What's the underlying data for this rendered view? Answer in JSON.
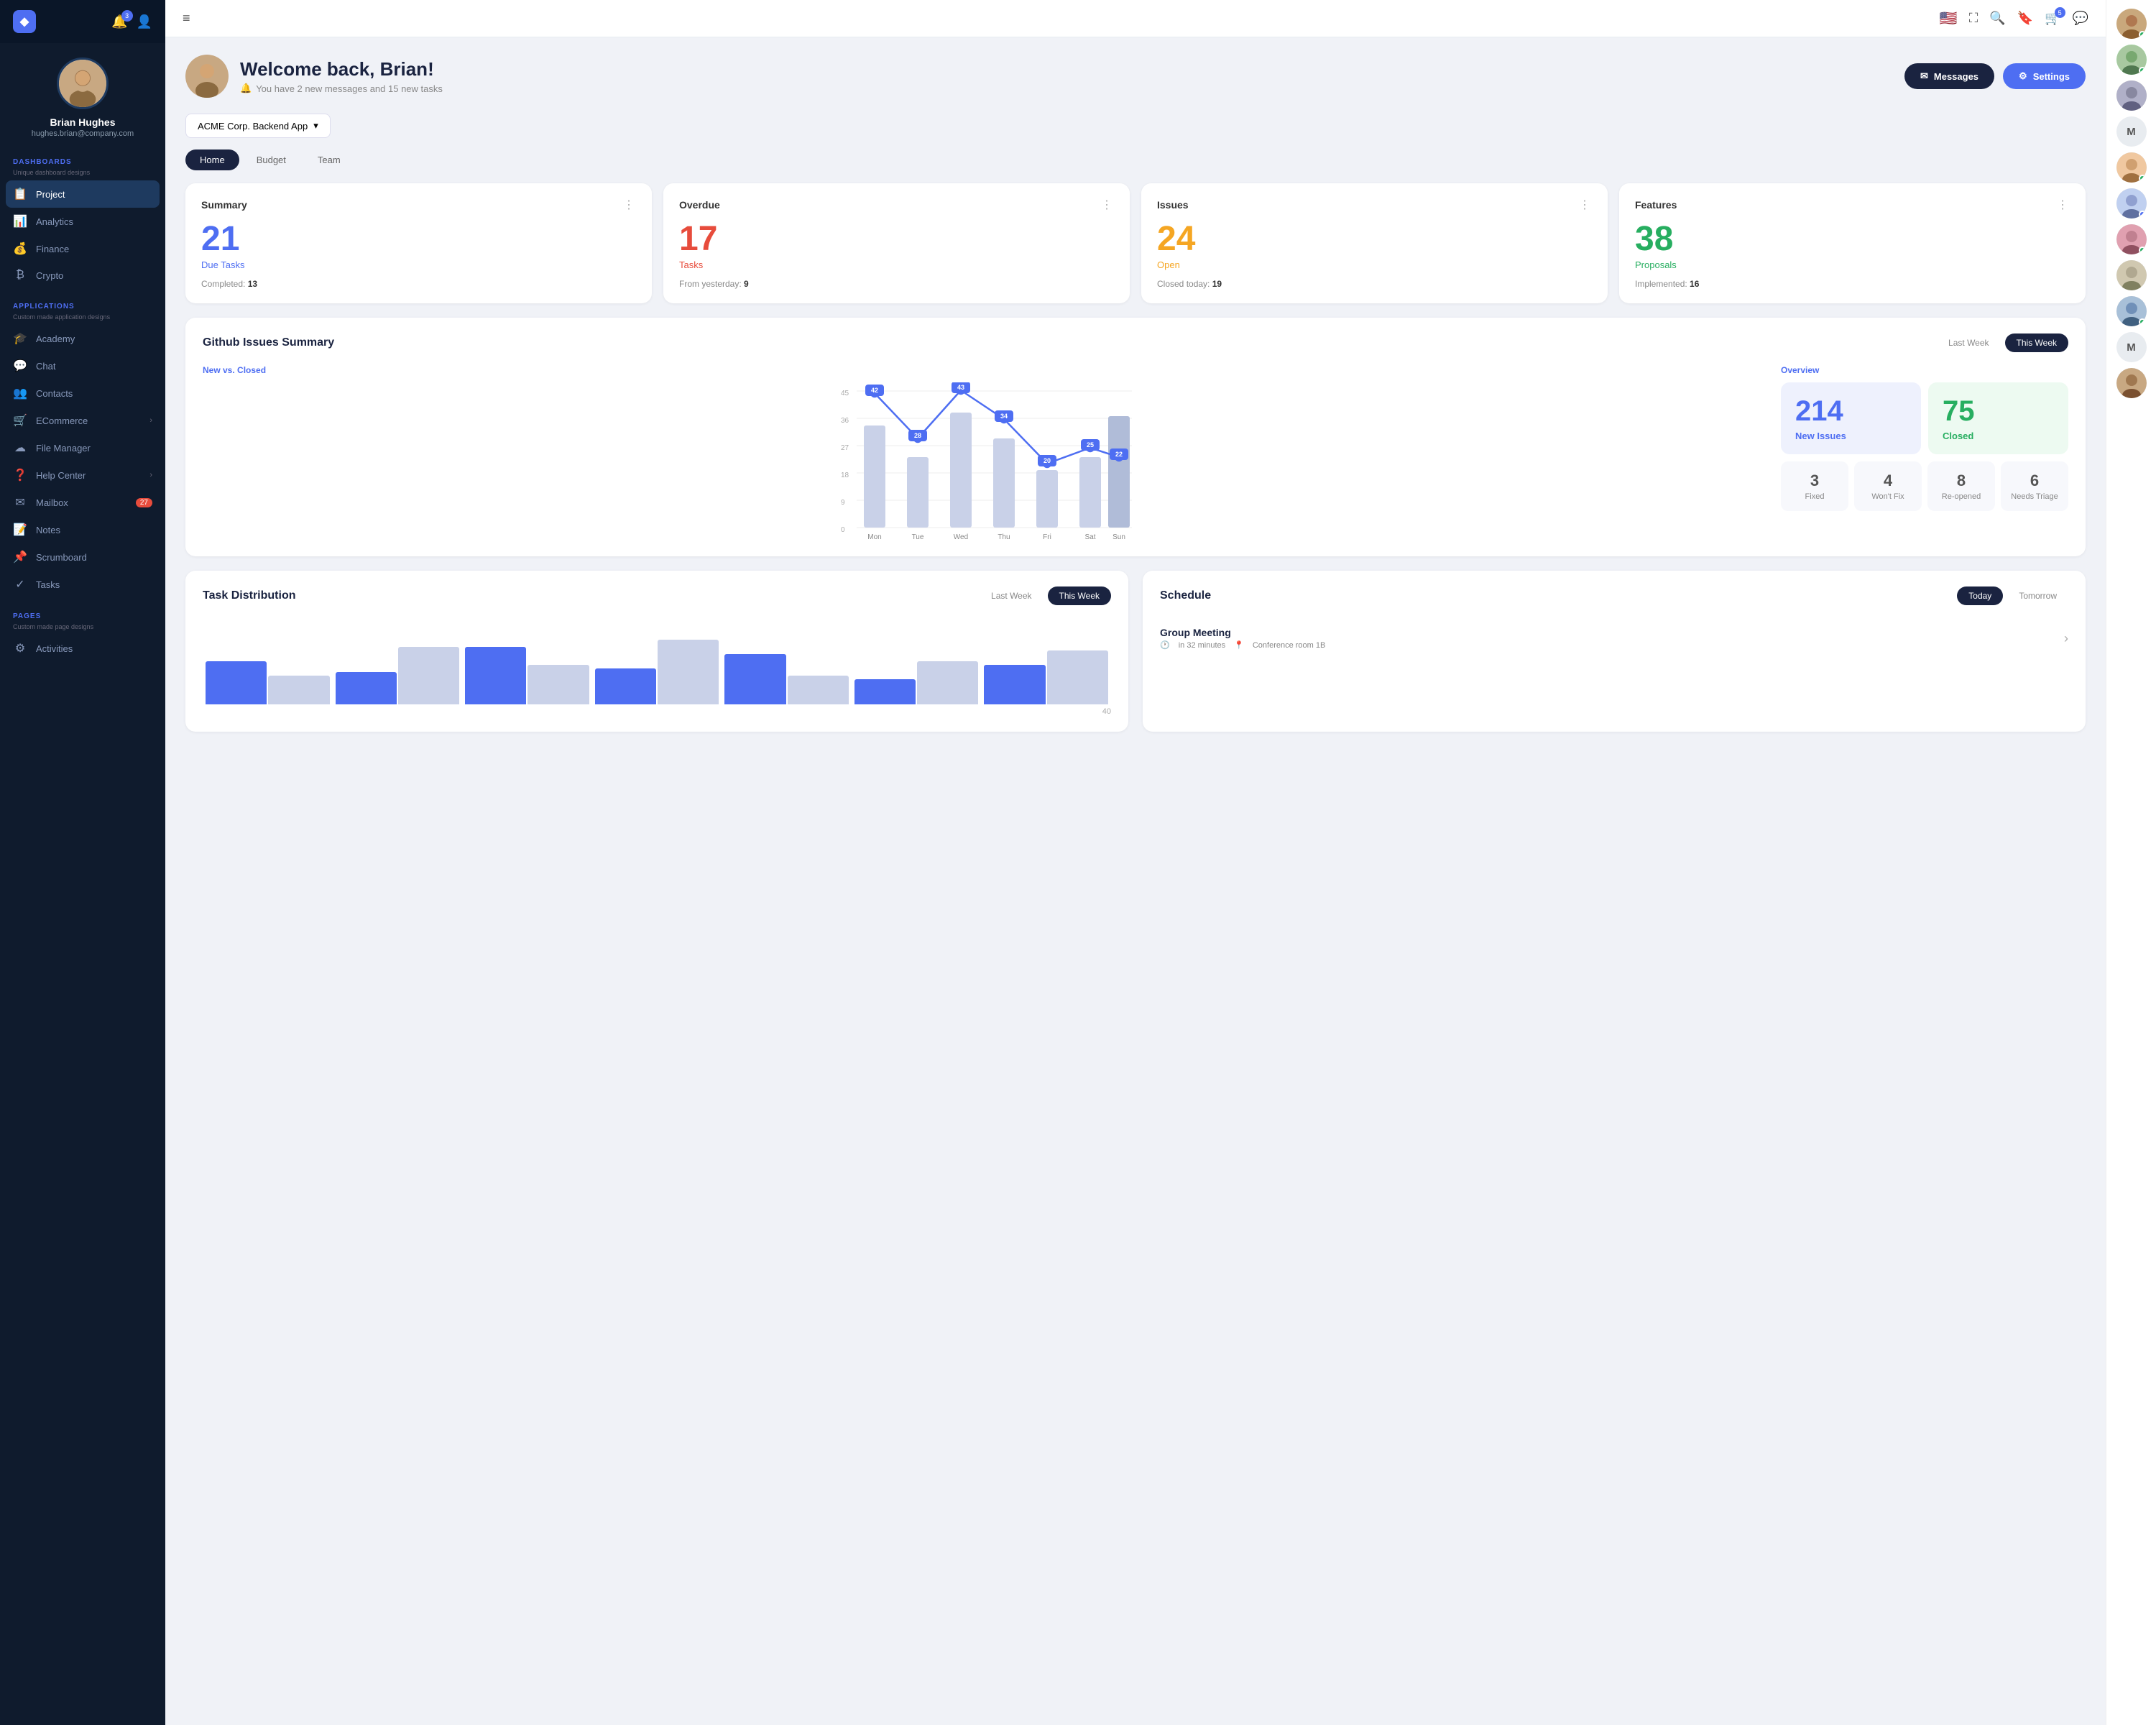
{
  "app": {
    "logo": "◆",
    "notification_count": "3",
    "menu_icon": "≡"
  },
  "sidebar": {
    "user": {
      "name": "Brian Hughes",
      "email": "hughes.brian@company.com"
    },
    "sections": [
      {
        "label": "DASHBOARDS",
        "sublabel": "Unique dashboard designs",
        "items": [
          {
            "icon": "📋",
            "label": "Project",
            "active": true
          },
          {
            "icon": "📊",
            "label": "Analytics"
          },
          {
            "icon": "💰",
            "label": "Finance"
          },
          {
            "icon": "₿",
            "label": "Crypto"
          }
        ]
      },
      {
        "label": "APPLICATIONS",
        "sublabel": "Custom made application designs",
        "items": [
          {
            "icon": "🎓",
            "label": "Academy"
          },
          {
            "icon": "💬",
            "label": "Chat"
          },
          {
            "icon": "👥",
            "label": "Contacts"
          },
          {
            "icon": "🛒",
            "label": "ECommerce",
            "arrow": "›"
          },
          {
            "icon": "☁",
            "label": "File Manager"
          },
          {
            "icon": "❓",
            "label": "Help Center",
            "arrow": "›"
          },
          {
            "icon": "✉",
            "label": "Mailbox",
            "badge": "27"
          },
          {
            "icon": "📝",
            "label": "Notes"
          },
          {
            "icon": "📌",
            "label": "Scrumboard"
          },
          {
            "icon": "✓",
            "label": "Tasks"
          }
        ]
      },
      {
        "label": "PAGES",
        "sublabel": "Custom made page designs",
        "items": [
          {
            "icon": "⚙",
            "label": "Activities"
          }
        ]
      }
    ]
  },
  "topbar": {
    "hamburger": "≡",
    "flag": "🇺🇸",
    "search_icon": "🔍",
    "bookmark_icon": "🔖",
    "cart_icon": "🛒",
    "cart_badge": "5",
    "messages_icon": "💬"
  },
  "welcome": {
    "title": "Welcome back, Brian!",
    "subtitle": "You have 2 new messages and 15 new tasks",
    "bell_icon": "🔔",
    "messages_btn": "Messages",
    "settings_btn": "Settings",
    "envelope_icon": "✉",
    "gear_icon": "⚙"
  },
  "project_selector": {
    "label": "ACME Corp. Backend App",
    "arrow": "▾"
  },
  "tabs": [
    {
      "label": "Home",
      "active": true
    },
    {
      "label": "Budget"
    },
    {
      "label": "Team"
    }
  ],
  "stats": [
    {
      "label": "Summary",
      "number": "21",
      "sublabel": "Due Tasks",
      "number_color": "#4e6ef2",
      "sublabel_color": "#4e6ef2",
      "footer_key": "Completed:",
      "footer_val": "13"
    },
    {
      "label": "Overdue",
      "number": "17",
      "sublabel": "Tasks",
      "number_color": "#e74c3c",
      "sublabel_color": "#e74c3c",
      "footer_key": "From yesterday:",
      "footer_val": "9"
    },
    {
      "label": "Issues",
      "number": "24",
      "sublabel": "Open",
      "number_color": "#f5a623",
      "sublabel_color": "#f5a623",
      "footer_key": "Closed today:",
      "footer_val": "19"
    },
    {
      "label": "Features",
      "number": "38",
      "sublabel": "Proposals",
      "number_color": "#27ae60",
      "sublabel_color": "#27ae60",
      "footer_key": "Implemented:",
      "footer_val": "16"
    }
  ],
  "github_issues": {
    "title": "Github Issues Summary",
    "last_week_btn": "Last Week",
    "this_week_btn": "This Week",
    "chart_subtitle": "New vs. Closed",
    "overview_title": "Overview",
    "chart_data": {
      "days": [
        "Mon",
        "Tue",
        "Wed",
        "Thu",
        "Fri",
        "Sat",
        "Sun"
      ],
      "line_values": [
        42,
        28,
        43,
        34,
        20,
        25,
        22
      ],
      "bar_values": [
        32,
        22,
        36,
        28,
        18,
        22,
        35
      ]
    },
    "overview": {
      "new_issues": "214",
      "new_issues_label": "New Issues",
      "closed": "75",
      "closed_label": "Closed",
      "fixed": "3",
      "fixed_label": "Fixed",
      "wont_fix": "4",
      "wont_fix_label": "Won't Fix",
      "reopened": "8",
      "reopened_label": "Re-opened",
      "needs_triage": "6",
      "needs_triage_label": "Needs Triage"
    }
  },
  "task_distribution": {
    "title": "Task Distribution",
    "last_week_btn": "Last Week",
    "this_week_btn": "This Week"
  },
  "schedule": {
    "title": "Schedule",
    "today_btn": "Today",
    "tomorrow_btn": "Tomorrow",
    "items": [
      {
        "title": "Group Meeting",
        "time": "in 32 minutes",
        "location": "Conference room 1B",
        "time_icon": "🕐",
        "loc_icon": "📍",
        "arrow": "›"
      }
    ]
  },
  "right_panel": {
    "avatars": [
      {
        "type": "img",
        "dot": "green"
      },
      {
        "type": "img",
        "dot": "green"
      },
      {
        "type": "img",
        "dot": ""
      },
      {
        "type": "initial",
        "letter": "M"
      },
      {
        "type": "img",
        "dot": "green"
      },
      {
        "type": "img",
        "dot": "blue"
      },
      {
        "type": "img",
        "dot": "green"
      },
      {
        "type": "img",
        "dot": ""
      },
      {
        "type": "img",
        "dot": "green"
      },
      {
        "type": "initial",
        "letter": "M"
      },
      {
        "type": "img",
        "dot": ""
      }
    ]
  }
}
